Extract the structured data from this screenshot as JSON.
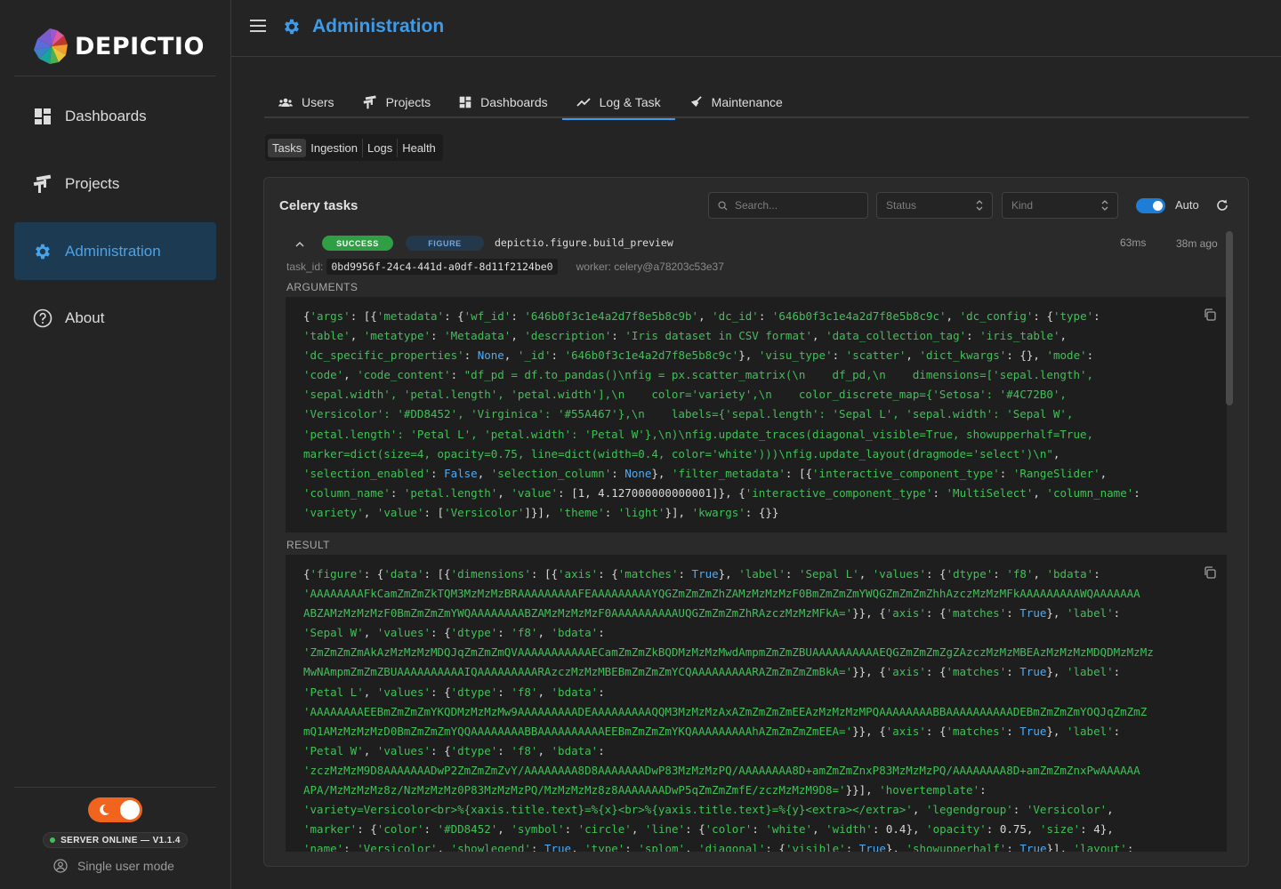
{
  "app": {
    "name": "DEPICTIO",
    "page_title": "Administration"
  },
  "sidebar": {
    "items": [
      {
        "label": "Dashboards",
        "icon": "dashboard-icon"
      },
      {
        "label": "Projects",
        "icon": "projects-icon"
      },
      {
        "label": "Administration",
        "icon": "gear-icon",
        "active": true
      },
      {
        "label": "About",
        "icon": "help-circle-icon"
      }
    ],
    "server_status": "SERVER ONLINE — V1.1.4",
    "user_mode": "Single user mode"
  },
  "tabs": [
    {
      "label": "Users",
      "icon": "users-icon"
    },
    {
      "label": "Projects",
      "icon": "projects-icon"
    },
    {
      "label": "Dashboards",
      "icon": "dashboard-icon"
    },
    {
      "label": "Log & Task",
      "icon": "trend-icon",
      "active": true
    },
    {
      "label": "Maintenance",
      "icon": "broom-icon"
    }
  ],
  "subtabs": [
    "Tasks",
    "Ingestion",
    "Logs",
    "Health"
  ],
  "panel": {
    "title": "Celery tasks",
    "search_placeholder": "Search...",
    "status_placeholder": "Status",
    "kind_placeholder": "Kind",
    "auto_label": "Auto"
  },
  "task": {
    "status": "SUCCESS",
    "kind": "FIGURE",
    "name": "depictio.figure.build_preview",
    "duration": "63ms",
    "ago": "38m ago",
    "task_id_label": "task_id:",
    "task_id": "0bd9956f-24c4-441d-a0df-8d11f2124be0",
    "worker": "worker: celery@a78203c53e37",
    "arguments_label": "ARGUMENTS",
    "result_label": "RESULT"
  },
  "colors": {
    "accent": "#3d9be9",
    "success": "#2f9e44",
    "string": "#40c057",
    "keyword": "#4dabf7",
    "toggle": "#f0641e"
  }
}
